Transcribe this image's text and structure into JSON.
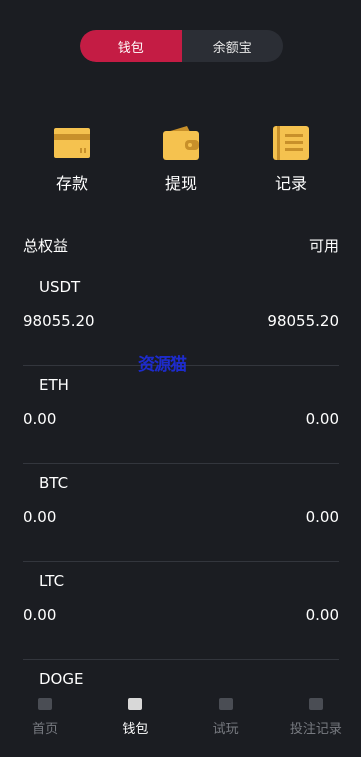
{
  "toggle": {
    "left": "钱包",
    "right": "余额宝"
  },
  "actions": [
    {
      "label": "存款",
      "icon": "card-icon"
    },
    {
      "label": "提现",
      "icon": "wallet-icon"
    },
    {
      "label": "记录",
      "icon": "list-icon"
    }
  ],
  "header": {
    "left": "总权益",
    "right": "可用"
  },
  "coins": [
    {
      "name": "USDT",
      "balance": "98055.20",
      "available": "98055.20"
    },
    {
      "name": "ETH",
      "balance": "0.00",
      "available": "0.00"
    },
    {
      "name": "BTC",
      "balance": "0.00",
      "available": "0.00"
    },
    {
      "name": "LTC",
      "balance": "0.00",
      "available": "0.00"
    },
    {
      "name": "DOGE",
      "balance": "",
      "available": ""
    }
  ],
  "watermark": "资源猫",
  "tabs": [
    {
      "label": "首页",
      "icon": "home-icon"
    },
    {
      "label": "钱包",
      "icon": "wallet-icon"
    },
    {
      "label": "试玩",
      "icon": "play-icon"
    },
    {
      "label": "投注记录",
      "icon": "record-icon"
    }
  ],
  "colors": {
    "accent": "#c41c44",
    "icon_gold": "#f5c24f",
    "background": "#1b1d22"
  }
}
